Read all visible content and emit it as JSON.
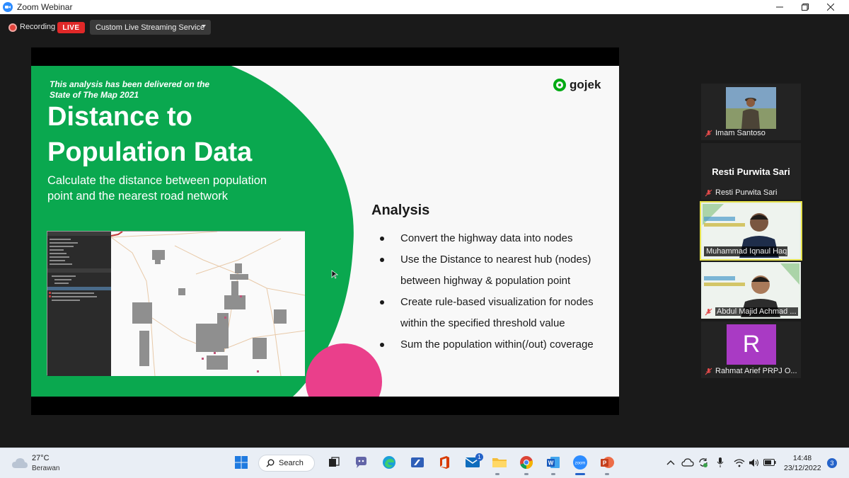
{
  "window": {
    "title": "Zoom Webinar",
    "controls": [
      "minimize-icon",
      "maximize-icon",
      "close-icon"
    ]
  },
  "recording_bar": {
    "recording_label": "Recording",
    "live_badge": "LIVE",
    "stream_button_label": "Custom Live Streaming Service",
    "live_color": "#e02828"
  },
  "slide": {
    "note": "This analysis has been delivered on the State of The Map 2021",
    "title": "Distance to Population Data",
    "subtitle": "Calculate the distance between population point and the nearest road network",
    "brand": "gojek",
    "analysis_heading": "Analysis",
    "bullets": [
      "Convert the highway data into nodes",
      "Use the Distance to nearest hub (nodes) between highway & population point",
      "Create rule-based visualization for nodes within the specified threshold value",
      "Sum the population within(/out) coverage"
    ],
    "colors": {
      "green": "#0aa84f",
      "pink": "#ea3f8b",
      "background": "#f8f8f8"
    }
  },
  "participants": [
    {
      "name": "Imam Santoso",
      "display": "photo",
      "muted": true
    },
    {
      "name": "Resti Purwita Sari",
      "display": "name",
      "big_name": "Resti Purwita Sari",
      "muted": true
    },
    {
      "name": "Muhammad Iqnaul Haq",
      "display": "video",
      "muted": false,
      "active_speaker": true
    },
    {
      "name": "Abdul Majid Achmad ...",
      "display": "video",
      "muted": true
    },
    {
      "name": "Rahmat Arief PRPJ O...",
      "display": "avatar",
      "avatar_letter": "R",
      "muted": true
    }
  ],
  "taskbar": {
    "weather": {
      "temp": "27°C",
      "desc": "Berawan"
    },
    "search_label": "Search",
    "apps": [
      "windows-start-icon",
      "search-icon",
      "task-view-icon",
      "teams-chat-icon",
      "edge-icon",
      "edit-app-icon",
      "office-icon",
      "mail-icon",
      "file-explorer-icon",
      "chrome-icon",
      "word-icon",
      "zoom-icon",
      "powerpoint-icon"
    ],
    "mail_badge": "1",
    "tray": [
      "chevron-up-icon",
      "onedrive-icon",
      "sync-icon",
      "mic-icon",
      "wifi-icon",
      "volume-icon",
      "battery-icon"
    ],
    "time": "14:48",
    "date": "23/12/2022",
    "notification_count": "3"
  }
}
